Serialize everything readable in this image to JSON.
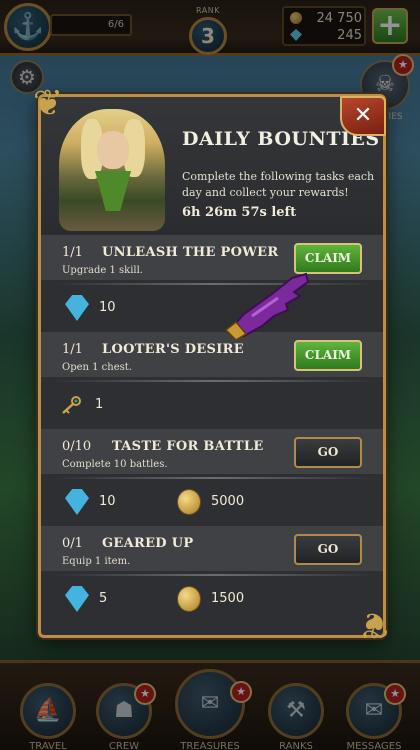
{
  "hud": {
    "energy": "6/6",
    "rank_label": "RANK",
    "rank_value": "3",
    "coins": "24 750",
    "gems": "245",
    "add_button": "+"
  },
  "background": {
    "bounties_tag": "TIES"
  },
  "nav": [
    {
      "label": "TRAVEL",
      "icon": "ship-icon"
    },
    {
      "label": "CREW",
      "icon": "crew-icon"
    },
    {
      "label": "TREASURES",
      "icon": "treasure-map-icon"
    },
    {
      "label": "RANKS",
      "icon": "anvil-icon"
    },
    {
      "label": "MESSAGES",
      "icon": "messages-icon"
    }
  ],
  "dialog": {
    "title": "DAILY BOUNTIES",
    "subtitle": "Complete the following tasks each day and collect your rewards!",
    "timer": "6h 26m 57s left",
    "close": "✕",
    "tasks": [
      {
        "count": "1/1",
        "name": "UNLEASH THE POWER",
        "desc": "Upgrade 1 skill.",
        "button": "CLAIM",
        "state": "claim",
        "rewards": [
          {
            "type": "gem",
            "amount": "10"
          }
        ]
      },
      {
        "count": "1/1",
        "name": "LOOTER'S DESIRE",
        "desc": "Open 1 chest.",
        "button": "CLAIM",
        "state": "claim",
        "rewards": [
          {
            "type": "key",
            "amount": "1"
          }
        ]
      },
      {
        "count": "0/10",
        "name": "TASTE FOR BATTLE",
        "desc": "Complete 10 battles.",
        "button": "GO",
        "state": "go",
        "rewards": [
          {
            "type": "gem",
            "amount": "10"
          },
          {
            "type": "coin",
            "amount": "5000"
          }
        ]
      },
      {
        "count": "0/1",
        "name": "GEARED UP",
        "desc": "Equip 1 item.",
        "button": "GO",
        "state": "go",
        "rewards": [
          {
            "type": "gem",
            "amount": "5"
          },
          {
            "type": "coin",
            "amount": "1500"
          }
        ]
      }
    ]
  },
  "colors": {
    "claim_green": "#4e9e30",
    "frame_gold": "#b8904a",
    "panel_dark": "#2d2f32",
    "close_red": "#9e3520"
  }
}
